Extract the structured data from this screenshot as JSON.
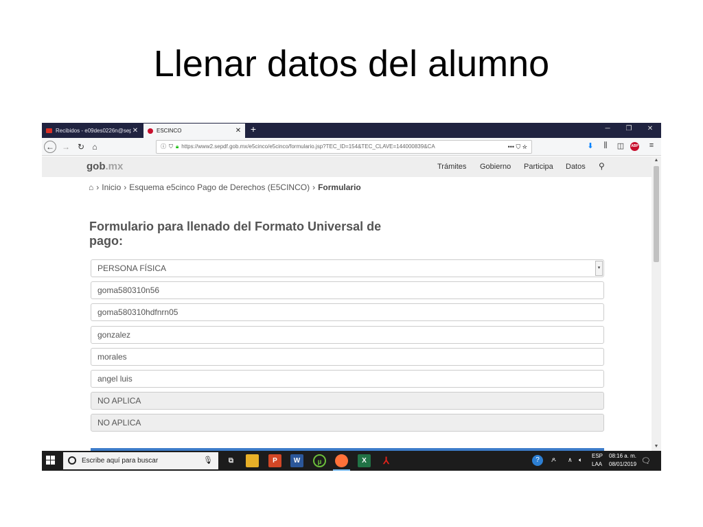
{
  "slide": {
    "title": "Llenar datos del alumno"
  },
  "browser": {
    "tabs": [
      {
        "label": "Recibidos - e09des0226n@sepd",
        "active": false
      },
      {
        "label": "ESCINCO",
        "active": true
      }
    ],
    "new_tab": "+",
    "url_host": "https://www2.sepdf.gob.mx",
    "url_path": "/e5cinco/e5cinco/formulario.jsp?TEC_ID=154&TEC_CLAVE=144000839&CA",
    "url_more": "••• ⛉ ☆"
  },
  "site": {
    "logo_main": "gob",
    "logo_suffix": ".mx",
    "nav": [
      "Trámites",
      "Gobierno",
      "Participa",
      "Datos"
    ]
  },
  "breadcrumb": {
    "home_icon": "⌂",
    "items": [
      "Inicio",
      "Esquema e5cinco Pago de Derechos (E5CINCO)"
    ],
    "current": "Formulario"
  },
  "form": {
    "title": "Formulario para llenado del Formato Universal de pago:",
    "person_type": "PERSONA FÍSICA",
    "fields": [
      {
        "value": "goma580310n56",
        "disabled": false
      },
      {
        "value": "goma580310hdfnrn05",
        "disabled": false
      },
      {
        "value": "gonzalez",
        "disabled": false
      },
      {
        "value": "morales",
        "disabled": false
      },
      {
        "value": "angel luis",
        "disabled": false
      },
      {
        "value": "NO APLICA",
        "disabled": true
      },
      {
        "value": "NO APLICA",
        "disabled": true
      }
    ]
  },
  "taskbar": {
    "search_placeholder": "Escribe aquí para buscar",
    "language": "ESP",
    "layout": "LAA",
    "time": "08:16 a. m.",
    "date": "08/01/2019"
  },
  "colors": {
    "tabbar_bg": "#202340",
    "header_bg": "#eeeeee",
    "submit_blue": "#3d7cc9",
    "taskbar_bg": "#1c1c1c"
  }
}
